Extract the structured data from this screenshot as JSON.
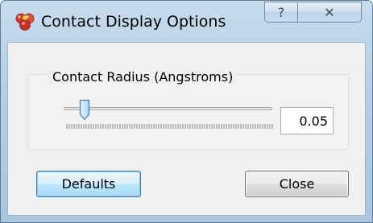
{
  "window": {
    "title": "Contact Display Options",
    "help_button": "?",
    "close_button": "✕"
  },
  "group": {
    "label": "Contact Radius (Angstroms)"
  },
  "slider": {
    "level": 0.1
  },
  "value_field": {
    "value": "0.05"
  },
  "buttons": {
    "defaults": "Defaults",
    "close": "Close"
  },
  "icons": {
    "app": "molecule-app-icon"
  },
  "colors": {
    "title_bar": "#b9d1e6",
    "default_button_border": "#3c7fb1"
  }
}
